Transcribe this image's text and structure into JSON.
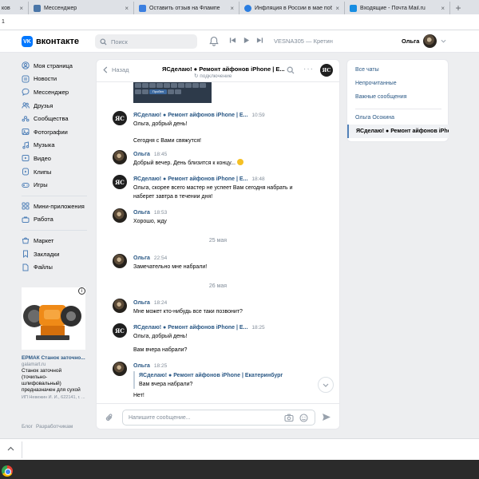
{
  "browser": {
    "tabs": [
      {
        "title": "ков",
        "type": "partial"
      },
      {
        "title": "Мессенджер",
        "type": "vk"
      },
      {
        "title": "Оставить отзыв на Флампе",
        "type": "flamp"
      },
      {
        "title": "Инфляция в России в мае побила",
        "type": "rbc"
      },
      {
        "title": "Входящие - Почта Mail.ru",
        "type": "mail"
      }
    ],
    "new_tab": "+",
    "address": "1"
  },
  "header": {
    "logo": "вконтакте",
    "search_placeholder": "Поиск",
    "track": "VESNA305 — Кретин",
    "user_name": "Ольга"
  },
  "leftnav": {
    "group1": [
      "Моя страница",
      "Новости",
      "Мессенджер",
      "Друзья",
      "Сообщества",
      "Фотографии",
      "Музыка",
      "Видео",
      "Клипы",
      "Игры"
    ],
    "group2": [
      "Мини-приложения",
      "Работа"
    ],
    "group3": [
      "Маркет",
      "Закладки",
      "Файлы"
    ]
  },
  "ad": {
    "info": "i",
    "title": "ЕРМАК Станок заточно...",
    "domain": "galamart.ru",
    "text_lines": [
      "Станок заточной",
      "(точильно-",
      "шлифовальный)",
      "предназначен для сухой"
    ],
    "legal": "ИП Невежин И. И., 622141, г. ..."
  },
  "footer": {
    "links": [
      "Блог",
      "Разработчикам"
    ]
  },
  "chat": {
    "back_label": "Назад",
    "title": "ЯСделаю! ● Ремонт айфонов iPhone | Е...",
    "status": "подключение",
    "avatar_text": "ЯС",
    "keyboard_key": "Пробел",
    "messages": {
      "m1": {
        "name": "ЯСделаю! ● Ремонт айфонов iPhone | Е...",
        "time": "10:59",
        "lines": [
          "Ольга, добрый день!",
          "Сегодня с Вами свяжутся!"
        ]
      },
      "m2": {
        "name": "Ольга",
        "time": "18:45",
        "text": "Добрый вечер. День близится к концу..."
      },
      "m3": {
        "name": "ЯСделаю! ● Ремонт айфонов iPhone | Е...",
        "time": "18:48",
        "lines": [
          "Ольга, скорее всего мастер не успеет Вам сегодня набрать и",
          "наберет завтра в течении дня!"
        ]
      },
      "m4": {
        "name": "Ольга",
        "time": "18:53",
        "text": "Хорошо, жду"
      },
      "date1": "25 мая",
      "m5": {
        "name": "Ольга",
        "time": "22:54",
        "text": "Замечательно мне набрали!"
      },
      "date2": "26 мая",
      "m6": {
        "name": "Ольга",
        "time": "18:24",
        "text": "Мне может кто-нибудь все таки позвонит?"
      },
      "m7": {
        "name": "ЯСделаю! ● Ремонт айфонов iPhone | Е...",
        "time": "18:25",
        "lines": [
          "Ольга, добрый день!",
          "Вам вчера набрали?"
        ]
      },
      "m8": {
        "name": "Ольга",
        "time": "18:25",
        "reply_name": "ЯСделаю! ● Ремонт айфонов iPhone | Екатеринбург",
        "reply_text": "Вам вчера набрали?",
        "text": "Нет!"
      }
    },
    "composer_placeholder": "Напишите сообщение..."
  },
  "rightpanel": {
    "all_chats": "Все чаты",
    "unread": "Непрочитанные",
    "important": "Важные сообщения",
    "contact": "Ольга Осокина",
    "active": "ЯСделаю! ● Ремонт айфонов iPhone"
  },
  "colors": {
    "accent": "#2a5885",
    "brand": "#0077ff",
    "background": "#edeef0"
  }
}
